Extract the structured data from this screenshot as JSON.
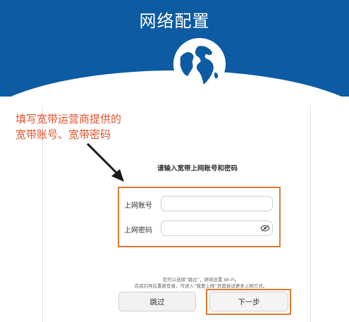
{
  "header": {
    "title": "网络配置"
  },
  "annotation": {
    "line1": "填写宽带运营商提供的",
    "line2": "宽带账号、宽带密码"
  },
  "form": {
    "heading": "请输入宽带上网账号和密码",
    "account_label": "上网账号",
    "account_value": "",
    "password_label": "上网密码",
    "password_value": ""
  },
  "notice": {
    "line1": "您可以选择“跳过”，继续设置 Wi-Fi。",
    "line2": "完成向导后重新登录，可进入“我要上网”页面尝试更多上网方式。"
  },
  "buttons": {
    "skip": "跳过",
    "next": "下一步"
  },
  "colors": {
    "header_blue": "#0d5ba2",
    "annotation_red": "#e0522c",
    "highlight_orange": "#e27a2d"
  },
  "icons": {
    "globe": "globe-icon",
    "eye": "eye-icon",
    "arrow": "arrow-icon"
  }
}
